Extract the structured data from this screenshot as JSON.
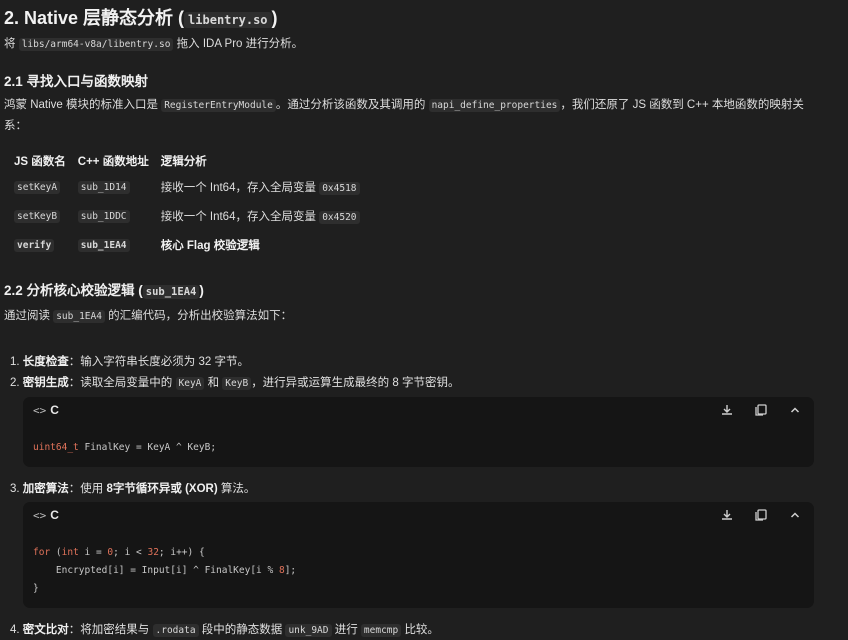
{
  "title": {
    "text": "2. Native 层静态分析 (",
    "code": "libentry.so",
    "end": ")"
  },
  "intro": {
    "a": "将",
    "code": "libs/arm64-v8a/libentry.so",
    "b": "拖入 IDA Pro 进行分析。"
  },
  "sec1": {
    "heading": "2.1 寻找入口与函数映射",
    "p_a": "鸿蒙 Native 模块的标准入口是",
    "p_code1": "RegisterEntryModule",
    "p_b": "。通过分析该函数及其调用的",
    "p_code2": "napi_define_properties",
    "p_c": "，我们还原了 JS 函数到 C++ 本地函数的映射关",
    "p_d": "系："
  },
  "table": {
    "headers": [
      "JS 函数名",
      "C++ 函数地址",
      "逻辑分析"
    ],
    "rows": [
      {
        "js": "setKeyA",
        "addr": "sub_1D14",
        "desc": "接收一个 Int64，存入全局变量",
        "var": "0x4518",
        "bold": false
      },
      {
        "js": "setKeyB",
        "addr": "sub_1DDC",
        "desc": "接收一个 Int64，存入全局变量",
        "var": "0x4520",
        "bold": false
      },
      {
        "js": "verify",
        "addr": "sub_1EA4",
        "desc": "核心 Flag 校验逻辑",
        "var": "",
        "bold": true
      }
    ]
  },
  "sec2": {
    "heading_a": "2.2 分析核心校验逻辑 (",
    "heading_code": "sub_1EA4",
    "heading_b": ")",
    "p_a": "通过阅读",
    "p_code": "sub_1EA4",
    "p_b": "的汇编代码，分析出校验算法如下："
  },
  "list": {
    "item1": {
      "num": "1.",
      "label": "长度检查",
      "text": "：输入字符串长度必须为 32 字节。"
    },
    "item2": {
      "num": "2.",
      "label": "密钥生成",
      "text_a": "：读取全局变量中的",
      "code1": "KeyA",
      "text_b": "和",
      "code2": "KeyB",
      "text_c": "，进行异或运算生成最终的 8 字节密钥。"
    },
    "item3": {
      "num": "3.",
      "label": "加密算法",
      "text_a": "：使用",
      "bold": "8字节循环异或 (XOR)",
      "text_b": "算法。"
    },
    "item4": {
      "num": "4.",
      "label": "密文比对",
      "text_a": "：将加密结果与",
      "code1": ".rodata",
      "text_b": "段中的静态数据",
      "code2": "unk_9AD",
      "text_c": "进行",
      "code3": "memcmp",
      "text_d": "比较。"
    }
  },
  "code1": {
    "lang": "C",
    "line_type": "uint64_t",
    "line_rest": " FinalKey = KeyA ^ KeyB;"
  },
  "code2": {
    "lang": "C",
    "l1_for": "for",
    "l1_a": " (",
    "l1_int": "int",
    "l1_b": " i = ",
    "l1_n0": "0",
    "l1_c": "; i < ",
    "l1_n32": "32",
    "l1_d": "; i++) {",
    "l2_a": "    Encrypted[i] = Input[i] ^ FinalKey[i % ",
    "l2_n8": "8",
    "l2_b": "];",
    "l3": "}"
  },
  "icons": [
    "code-chevrons-icon",
    "download-icon",
    "copy-icon",
    "collapse-icon"
  ]
}
